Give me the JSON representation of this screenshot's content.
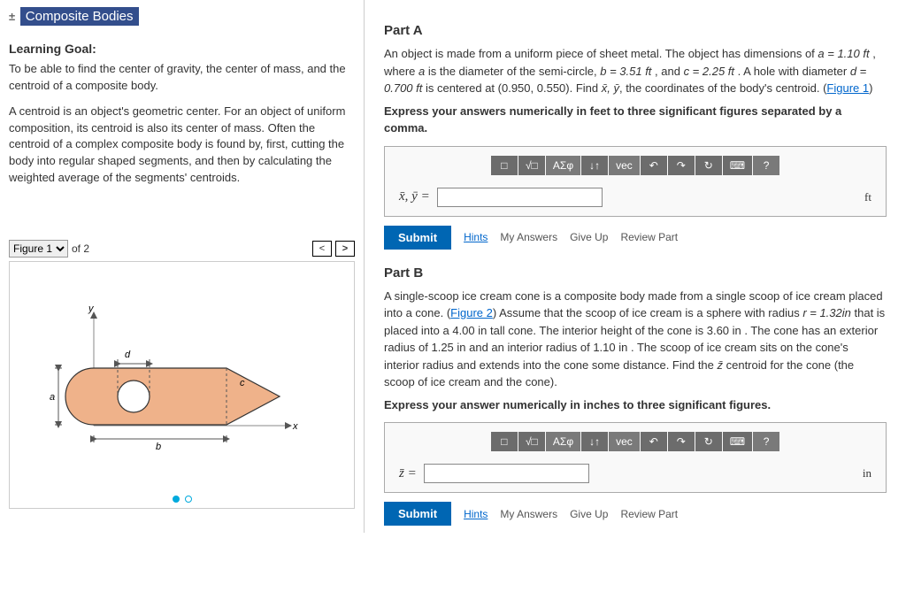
{
  "sidebar": {
    "title": "Composite Bodies",
    "learning_goal_label": "Learning Goal:",
    "learning_goal": "To be able to find the center of gravity, the center of mass, and the centroid of a composite body.",
    "description": "A centroid is an object's geometric center. For an object of uniform composition, its centroid is also its center of mass. Often the centroid of a complex composite body is found by, first, cutting the body into regular shaped segments, and then by calculating the weighted average of the segments' centroids.",
    "figure": {
      "select_label": "Figure 1",
      "of_label": "of 2"
    }
  },
  "partA": {
    "label": "Part A",
    "text1": "An object is made from a uniform piece of sheet metal. The object has dimensions of ",
    "a_eq": "a = 1.10 ft",
    "text2": " , where ",
    "a_desc": "a",
    "text3": " is the diameter of the semi-circle, ",
    "b_eq": "b = 3.51 ft",
    "text4": " , and ",
    "c_eq": "c = 2.25 ft",
    "text5": " . A hole with diameter ",
    "d_eq": "d = 0.700 ft",
    "text6": " is centered at ",
    "center": "(0.950, 0.550)",
    "text7": ". Find ",
    "xy": "x̄, ȳ",
    "text8": ", the coordinates of the body's centroid. (",
    "figlink": "Figure 1",
    "text9": ")",
    "instruction": "Express your answers numerically in feet to three significant figures separated by a comma.",
    "answer_label": "x̄, ȳ =",
    "unit": "ft",
    "submit": "Submit",
    "hints": "Hints",
    "myanswers": "My Answers",
    "giveup": "Give Up",
    "review": "Review Part"
  },
  "partB": {
    "label": "Part B",
    "text1": "A single-scoop ice cream cone is a composite body made from a single scoop of ice cream placed into a cone. (",
    "figlink": "Figure 2",
    "text2": ") Assume that the scoop of ice cream is a sphere with radius ",
    "r_eq": "r = 1.32in",
    "text3": " that is placed into a 4.00 ",
    "in1": "in",
    "text4": " tall cone. The interior height of the cone is 3.60 ",
    "in2": "in",
    "text5": " . The cone has an exterior radius of 1.25 ",
    "in3": "in",
    "text6": " and an interior radius of 1.10 ",
    "in4": "in",
    "text7": " . The scoop of ice cream sits on the cone's interior radius and extends into the cone some distance. Find the ",
    "z": "z̄",
    "text8": " centroid for the cone (the scoop of ice cream and the cone).",
    "instruction": "Express your answer numerically in inches to three significant figures.",
    "answer_label": "z̄ =",
    "unit": "in",
    "submit": "Submit",
    "hints": "Hints",
    "myanswers": "My Answers",
    "giveup": "Give Up",
    "review": "Review Part"
  },
  "toolbar": {
    "tmpl": "□",
    "sqrt": "√□",
    "greek": "ΑΣφ",
    "subsup": "↓↑",
    "vec": "vec",
    "undo": "↶",
    "redo": "↷",
    "reset": "↻",
    "keyboard": "⌨",
    "help": "?"
  }
}
